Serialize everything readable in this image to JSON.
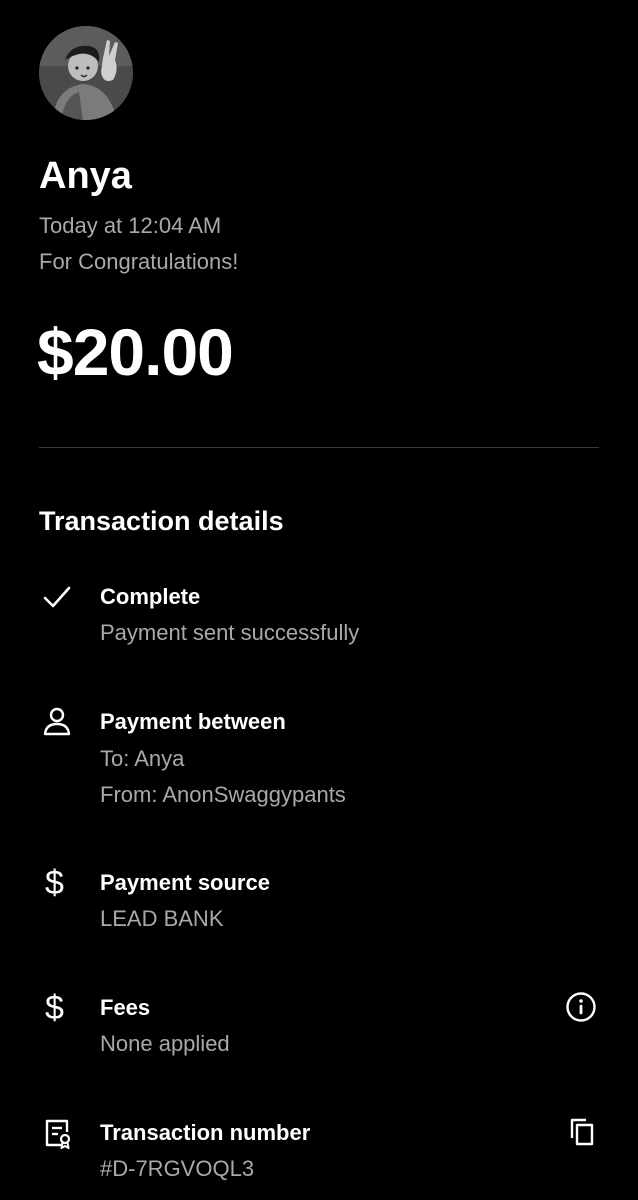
{
  "recipient": {
    "name": "Anya",
    "avatar": "profile-photo"
  },
  "payment": {
    "time": "Today at 12:04 AM",
    "note": "For Congratulations!",
    "amount": "$20.00"
  },
  "details": {
    "title": "Transaction details",
    "status": {
      "icon": "check-icon",
      "label": "Complete",
      "sub": "Payment sent successfully"
    },
    "between": {
      "icon": "person-icon",
      "label": "Payment between",
      "to": "To: Anya",
      "from": "From: AnonSwaggypants"
    },
    "source": {
      "icon": "dollar-icon",
      "icon_glyph": "$",
      "label": "Payment source",
      "sub": "LEAD BANK"
    },
    "fees": {
      "icon": "dollar-icon",
      "icon_glyph": "$",
      "label": "Fees",
      "sub": "None applied",
      "action_icon": "info-icon"
    },
    "transaction_number": {
      "icon": "receipt-icon",
      "label": "Transaction number",
      "sub": "#D-7RGVOQL3",
      "action_icon": "copy-icon"
    }
  },
  "colors": {
    "background": "#000000",
    "primary_text": "#ffffff",
    "secondary_text": "#a9a9a9",
    "divider": "#3a3a3a"
  }
}
